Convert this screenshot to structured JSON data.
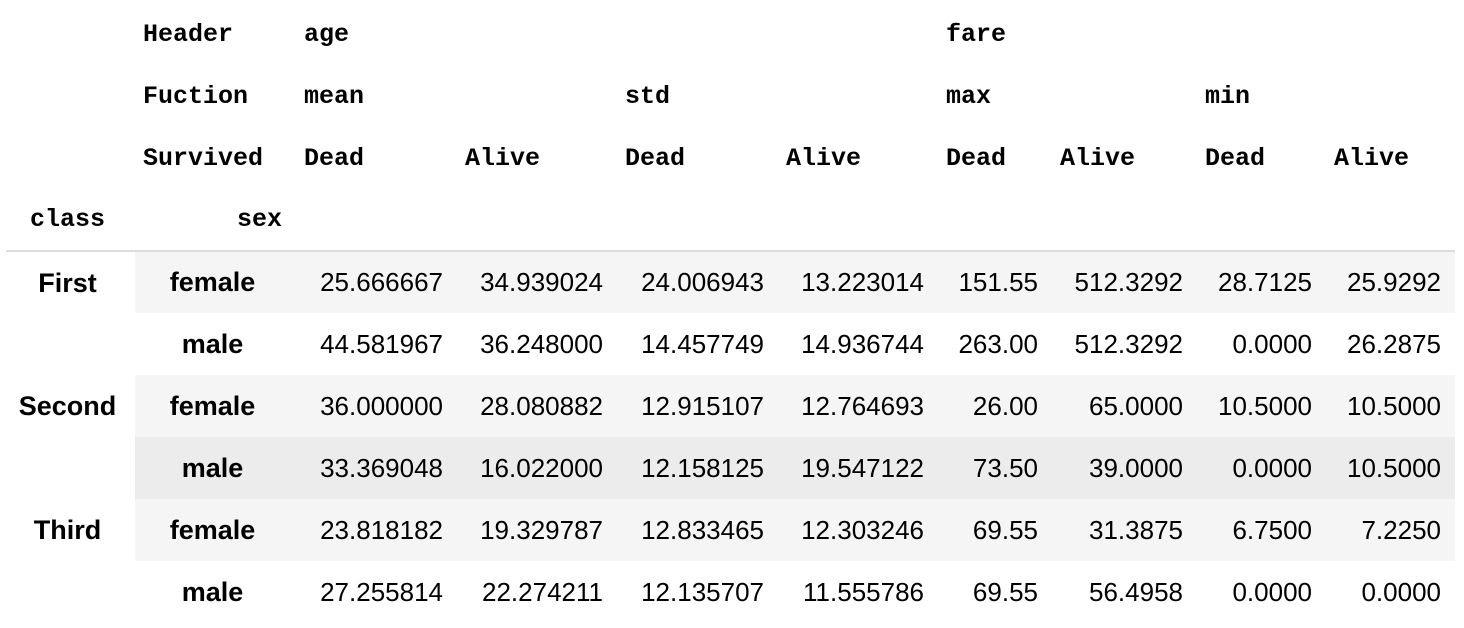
{
  "header": {
    "level0_name": "Header",
    "level1_name": "Fuction",
    "level2_name": "Survived",
    "groups": [
      {
        "label": "age",
        "functions": [
          {
            "label": "mean",
            "outcomes": [
              "Dead",
              "Alive"
            ]
          },
          {
            "label": "std",
            "outcomes": [
              "Dead",
              "Alive"
            ]
          }
        ]
      },
      {
        "label": "fare",
        "functions": [
          {
            "label": "max",
            "outcomes": [
              "Dead",
              "Alive"
            ]
          },
          {
            "label": "min",
            "outcomes": [
              "Dead",
              "Alive"
            ]
          }
        ]
      }
    ],
    "index_names": [
      "class",
      "sex"
    ]
  },
  "rows": [
    {
      "class": "First",
      "sex": "female",
      "values": [
        "25.666667",
        "34.939024",
        "24.006943",
        "13.223014",
        "151.55",
        "512.3292",
        "28.7125",
        "25.9292"
      ]
    },
    {
      "class": "",
      "sex": "male",
      "values": [
        "44.581967",
        "36.248000",
        "14.457749",
        "14.936744",
        "263.00",
        "512.3292",
        "0.0000",
        "26.2875"
      ]
    },
    {
      "class": "Second",
      "sex": "female",
      "values": [
        "36.000000",
        "28.080882",
        "12.915107",
        "12.764693",
        "26.00",
        "65.0000",
        "10.5000",
        "10.5000"
      ]
    },
    {
      "class": "",
      "sex": "male",
      "values": [
        "33.369048",
        "16.022000",
        "12.158125",
        "19.547122",
        "73.50",
        "39.0000",
        "0.0000",
        "10.5000"
      ]
    },
    {
      "class": "Third",
      "sex": "female",
      "values": [
        "23.818182",
        "19.329787",
        "12.833465",
        "12.303246",
        "69.55",
        "31.3875",
        "6.7500",
        "7.2250"
      ]
    },
    {
      "class": "",
      "sex": "male",
      "values": [
        "27.255814",
        "22.274211",
        "12.135707",
        "11.555786",
        "69.55",
        "56.4958",
        "0.0000",
        "0.0000"
      ]
    }
  ]
}
